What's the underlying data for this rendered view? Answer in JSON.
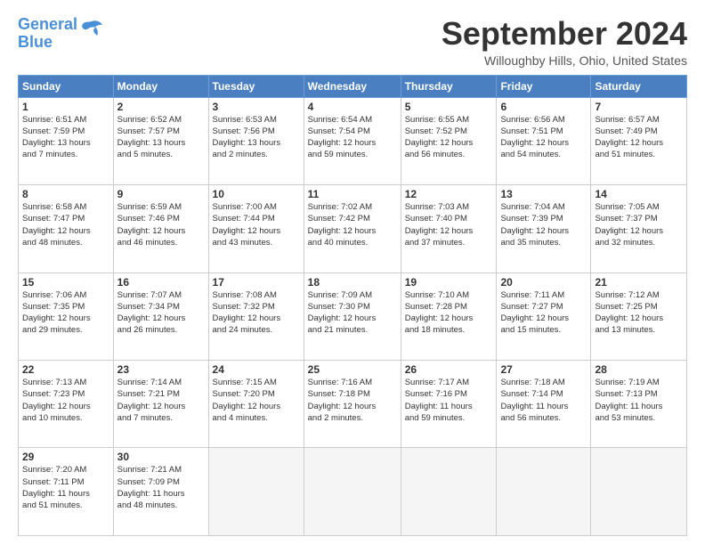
{
  "header": {
    "logo_line1": "General",
    "logo_line2": "Blue",
    "month_title": "September 2024",
    "subtitle": "Willoughby Hills, Ohio, United States"
  },
  "days_of_week": [
    "Sunday",
    "Monday",
    "Tuesday",
    "Wednesday",
    "Thursday",
    "Friday",
    "Saturday"
  ],
  "weeks": [
    [
      {
        "day": "1",
        "info": "Sunrise: 6:51 AM\nSunset: 7:59 PM\nDaylight: 13 hours\nand 7 minutes."
      },
      {
        "day": "2",
        "info": "Sunrise: 6:52 AM\nSunset: 7:57 PM\nDaylight: 13 hours\nand 5 minutes."
      },
      {
        "day": "3",
        "info": "Sunrise: 6:53 AM\nSunset: 7:56 PM\nDaylight: 13 hours\nand 2 minutes."
      },
      {
        "day": "4",
        "info": "Sunrise: 6:54 AM\nSunset: 7:54 PM\nDaylight: 12 hours\nand 59 minutes."
      },
      {
        "day": "5",
        "info": "Sunrise: 6:55 AM\nSunset: 7:52 PM\nDaylight: 12 hours\nand 56 minutes."
      },
      {
        "day": "6",
        "info": "Sunrise: 6:56 AM\nSunset: 7:51 PM\nDaylight: 12 hours\nand 54 minutes."
      },
      {
        "day": "7",
        "info": "Sunrise: 6:57 AM\nSunset: 7:49 PM\nDaylight: 12 hours\nand 51 minutes."
      }
    ],
    [
      {
        "day": "8",
        "info": "Sunrise: 6:58 AM\nSunset: 7:47 PM\nDaylight: 12 hours\nand 48 minutes."
      },
      {
        "day": "9",
        "info": "Sunrise: 6:59 AM\nSunset: 7:46 PM\nDaylight: 12 hours\nand 46 minutes."
      },
      {
        "day": "10",
        "info": "Sunrise: 7:00 AM\nSunset: 7:44 PM\nDaylight: 12 hours\nand 43 minutes."
      },
      {
        "day": "11",
        "info": "Sunrise: 7:02 AM\nSunset: 7:42 PM\nDaylight: 12 hours\nand 40 minutes."
      },
      {
        "day": "12",
        "info": "Sunrise: 7:03 AM\nSunset: 7:40 PM\nDaylight: 12 hours\nand 37 minutes."
      },
      {
        "day": "13",
        "info": "Sunrise: 7:04 AM\nSunset: 7:39 PM\nDaylight: 12 hours\nand 35 minutes."
      },
      {
        "day": "14",
        "info": "Sunrise: 7:05 AM\nSunset: 7:37 PM\nDaylight: 12 hours\nand 32 minutes."
      }
    ],
    [
      {
        "day": "15",
        "info": "Sunrise: 7:06 AM\nSunset: 7:35 PM\nDaylight: 12 hours\nand 29 minutes."
      },
      {
        "day": "16",
        "info": "Sunrise: 7:07 AM\nSunset: 7:34 PM\nDaylight: 12 hours\nand 26 minutes."
      },
      {
        "day": "17",
        "info": "Sunrise: 7:08 AM\nSunset: 7:32 PM\nDaylight: 12 hours\nand 24 minutes."
      },
      {
        "day": "18",
        "info": "Sunrise: 7:09 AM\nSunset: 7:30 PM\nDaylight: 12 hours\nand 21 minutes."
      },
      {
        "day": "19",
        "info": "Sunrise: 7:10 AM\nSunset: 7:28 PM\nDaylight: 12 hours\nand 18 minutes."
      },
      {
        "day": "20",
        "info": "Sunrise: 7:11 AM\nSunset: 7:27 PM\nDaylight: 12 hours\nand 15 minutes."
      },
      {
        "day": "21",
        "info": "Sunrise: 7:12 AM\nSunset: 7:25 PM\nDaylight: 12 hours\nand 13 minutes."
      }
    ],
    [
      {
        "day": "22",
        "info": "Sunrise: 7:13 AM\nSunset: 7:23 PM\nDaylight: 12 hours\nand 10 minutes."
      },
      {
        "day": "23",
        "info": "Sunrise: 7:14 AM\nSunset: 7:21 PM\nDaylight: 12 hours\nand 7 minutes."
      },
      {
        "day": "24",
        "info": "Sunrise: 7:15 AM\nSunset: 7:20 PM\nDaylight: 12 hours\nand 4 minutes."
      },
      {
        "day": "25",
        "info": "Sunrise: 7:16 AM\nSunset: 7:18 PM\nDaylight: 12 hours\nand 2 minutes."
      },
      {
        "day": "26",
        "info": "Sunrise: 7:17 AM\nSunset: 7:16 PM\nDaylight: 11 hours\nand 59 minutes."
      },
      {
        "day": "27",
        "info": "Sunrise: 7:18 AM\nSunset: 7:14 PM\nDaylight: 11 hours\nand 56 minutes."
      },
      {
        "day": "28",
        "info": "Sunrise: 7:19 AM\nSunset: 7:13 PM\nDaylight: 11 hours\nand 53 minutes."
      }
    ],
    [
      {
        "day": "29",
        "info": "Sunrise: 7:20 AM\nSunset: 7:11 PM\nDaylight: 11 hours\nand 51 minutes."
      },
      {
        "day": "30",
        "info": "Sunrise: 7:21 AM\nSunset: 7:09 PM\nDaylight: 11 hours\nand 48 minutes."
      },
      {
        "day": "",
        "info": ""
      },
      {
        "day": "",
        "info": ""
      },
      {
        "day": "",
        "info": ""
      },
      {
        "day": "",
        "info": ""
      },
      {
        "day": "",
        "info": ""
      }
    ]
  ]
}
